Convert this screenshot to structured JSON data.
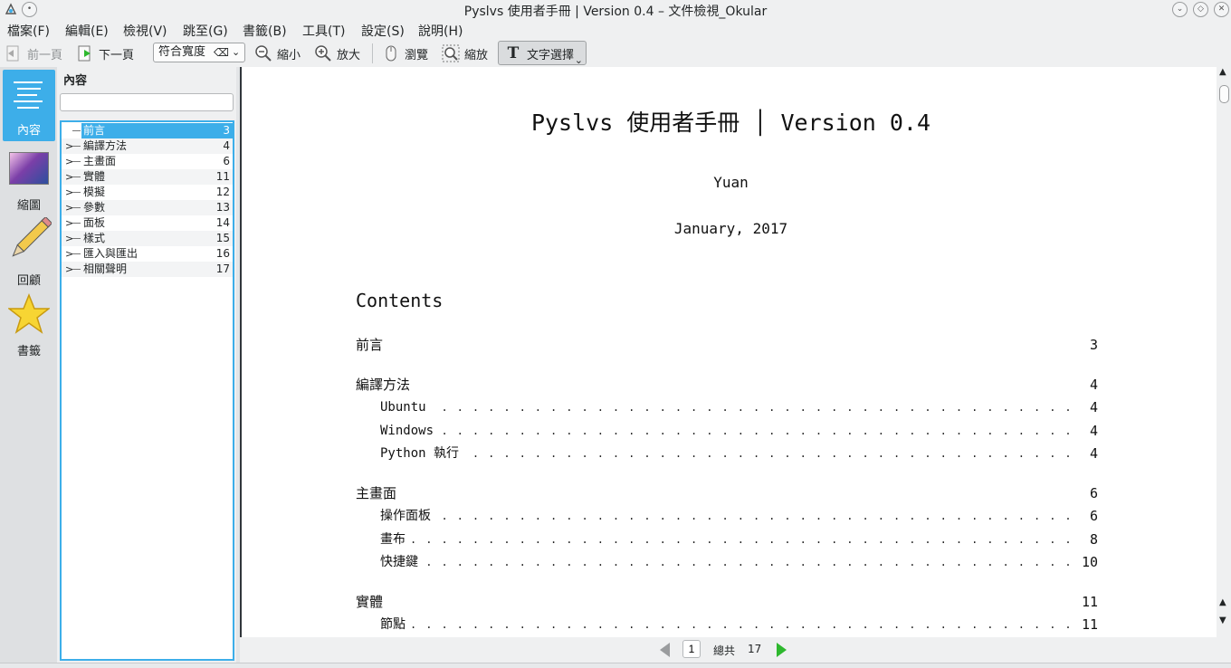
{
  "window": {
    "title": "Pyslvs 使用者手冊 | Version 0.4 – 文件檢視_Okular"
  },
  "menu": [
    "檔案(F)",
    "編輯(E)",
    "檢視(V)",
    "跳至(G)",
    "書籤(B)",
    "工具(T)",
    "設定(S)",
    "說明(H)"
  ],
  "toolbar": {
    "prev": "前一頁",
    "next": "下一頁",
    "zoom_mode": "符合寬度",
    "zoom_out": "縮小",
    "zoom_in": "放大",
    "browse": "瀏覽",
    "zoom_tool": "縮放",
    "text_select": "文字選擇"
  },
  "sidebar": {
    "items": [
      "內容",
      "縮圖",
      "回顧",
      "書籤"
    ],
    "active": "內容"
  },
  "toc_panel": {
    "title": "內容",
    "search_value": "",
    "entries": [
      {
        "label": "前言",
        "page": "3",
        "expandable": false,
        "selected": true
      },
      {
        "label": "編譯方法",
        "page": "4",
        "expandable": true
      },
      {
        "label": "主畫面",
        "page": "6",
        "expandable": true
      },
      {
        "label": "實體",
        "page": "11",
        "expandable": true
      },
      {
        "label": "模擬",
        "page": "12",
        "expandable": true
      },
      {
        "label": "參數",
        "page": "13",
        "expandable": true
      },
      {
        "label": "面板",
        "page": "14",
        "expandable": true
      },
      {
        "label": "樣式",
        "page": "15",
        "expandable": true
      },
      {
        "label": "匯入與匯出",
        "page": "16",
        "expandable": true
      },
      {
        "label": "相關聲明",
        "page": "17",
        "expandable": true
      }
    ]
  },
  "document": {
    "title": "Pyslvs 使用者手冊 │ Version 0.4",
    "author": "Yuan",
    "date": "January, 2017",
    "contents_heading": "Contents",
    "toc": [
      {
        "text": "前言",
        "page": "3",
        "level": 0
      },
      {
        "text": "編譯方法",
        "page": "4",
        "level": 0
      },
      {
        "text": "Ubuntu",
        "page": "4",
        "level": 1
      },
      {
        "text": "Windows",
        "page": "4",
        "level": 1
      },
      {
        "text": "Python 執行",
        "page": "4",
        "level": 1
      },
      {
        "text": "主畫面",
        "page": "6",
        "level": 0
      },
      {
        "text": "操作面板",
        "page": "6",
        "level": 1
      },
      {
        "text": "畫布",
        "page": "8",
        "level": 1
      },
      {
        "text": "快捷鍵",
        "page": "10",
        "level": 1
      },
      {
        "text": "實體",
        "page": "11",
        "level": 0
      },
      {
        "text": "節點",
        "page": "11",
        "level": 1
      }
    ]
  },
  "pager": {
    "current_page": "1",
    "total_label": "總共",
    "total_pages": "17"
  },
  "colors": {
    "accent": "#3daee9",
    "next_arrow": "#2eb82e",
    "prev_arrow_disabled": "#9a9c9e"
  }
}
